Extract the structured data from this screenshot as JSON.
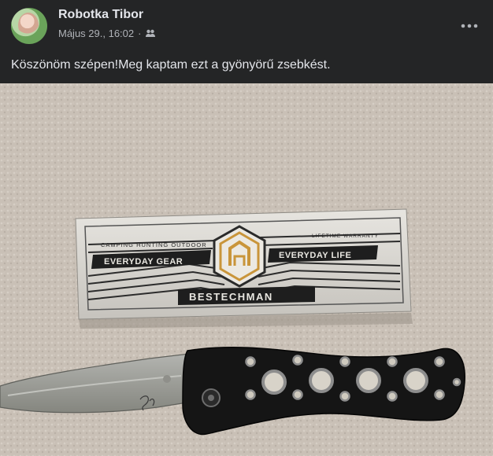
{
  "post": {
    "author": "Robotka Tibor",
    "timestamp": "Május 29., 16:02",
    "separator": "·",
    "text": "Köszönöm szépen!Meg kaptam ezt a gyönyörű zsebkést.",
    "audience_icon": "friends-icon",
    "more_icon": "more-dots-icon"
  },
  "photo": {
    "box": {
      "top_left_label": "CAMPING HUNTING OUTDOOR",
      "top_right_label": "LIFETIME WARRANTY",
      "left_band": "EVERYDAY GEAR",
      "right_band": "EVERYDAY LIFE",
      "brand": "BESTECHMAN"
    },
    "colors": {
      "carpet": "#c9c0b6",
      "box": "#dcdad5",
      "handle": "#141414",
      "blade": "#9c9d98",
      "logo_gold": "#c9953a"
    }
  }
}
